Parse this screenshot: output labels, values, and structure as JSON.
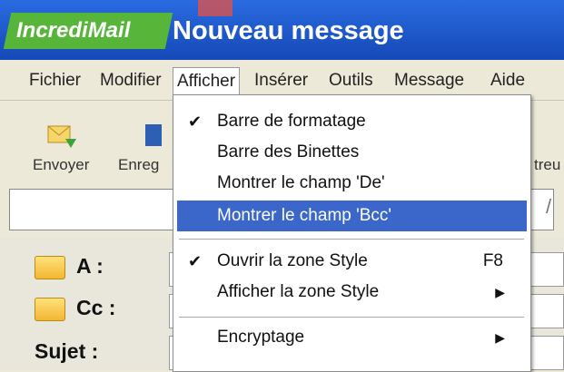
{
  "window": {
    "brand": "IncrediMail",
    "title": "Nouveau message"
  },
  "menubar": {
    "items": [
      "Fichier",
      "Modifier",
      "Afficher",
      "Insérer",
      "Outils",
      "Message",
      "Aide"
    ],
    "open_item": "Afficher"
  },
  "toolbar": {
    "send_label": "Envoyer",
    "save_label": "Enreg",
    "right_label": "treu"
  },
  "fields": {
    "to_label": "A :",
    "cc_label": "Cc :",
    "subject_label": "Sujet :"
  },
  "dropdown": {
    "items": [
      {
        "label": "Barre de formatage",
        "checked": true
      },
      {
        "label": "Barre des Binettes",
        "checked": false
      },
      {
        "label": "Montrer le champ 'De'",
        "checked": false
      },
      {
        "label": "Montrer le champ 'Bcc'",
        "checked": false,
        "highlighted": true
      },
      {
        "label": "Ouvrir la zone Style",
        "checked": true,
        "shortcut": "F8"
      },
      {
        "label": "Afficher la zone Style",
        "checked": false,
        "submenu": true
      },
      {
        "label": "Encryptage",
        "checked": false,
        "submenu": true
      }
    ]
  },
  "colors": {
    "title_bar": "#1d56c8",
    "brand_bg": "#57b53a",
    "highlight": "#3a67c9"
  }
}
